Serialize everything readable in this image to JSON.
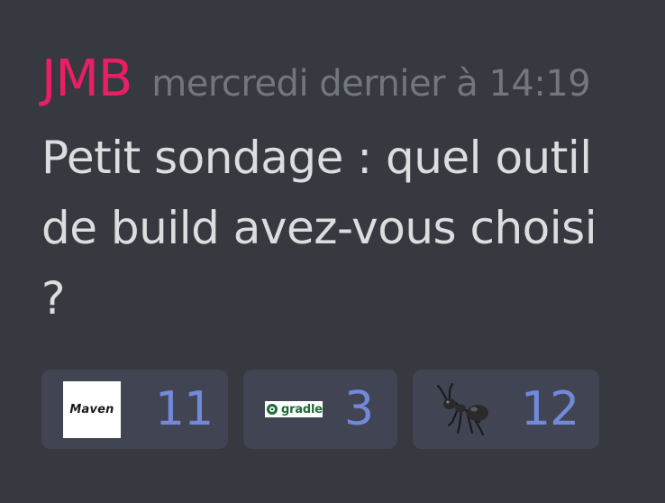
{
  "message": {
    "author": "JMB",
    "timestamp": "mercredi dernier à 14:19",
    "content": "Petit sondage : quel outil de build avez-vous choisi ?",
    "author_color": "#e91e63"
  },
  "reactions": [
    {
      "emoji_name": "maven-icon",
      "emoji_text": "Maven",
      "count": "11"
    },
    {
      "emoji_name": "gradle-icon",
      "emoji_text": "gradle",
      "count": "3"
    },
    {
      "emoji_name": "ant-icon",
      "count": "12"
    }
  ],
  "colors": {
    "background": "#36393f",
    "reaction_bg": "#414553",
    "count": "#7289da",
    "timestamp": "#72767d",
    "text": "#dcddde"
  }
}
